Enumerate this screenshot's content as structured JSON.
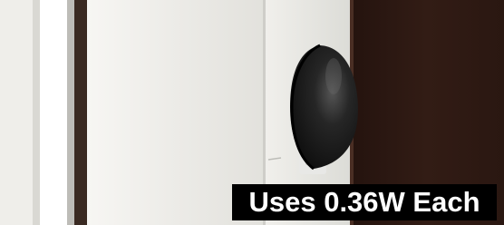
{
  "caption": {
    "text": "Uses 0.36W Each"
  },
  "scene": {
    "objects": [
      "white-door-frame",
      "black-dome-device",
      "dark-wood-door"
    ],
    "colors": {
      "caption_background": "#000000",
      "caption_text": "#ffffff",
      "device": "#1a1a1a",
      "wood": "#2b1812",
      "wall": "#eeede9"
    }
  }
}
